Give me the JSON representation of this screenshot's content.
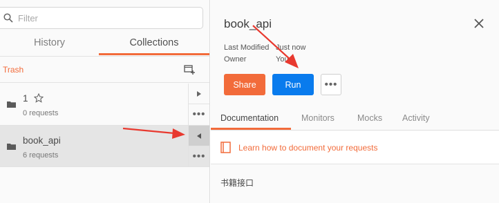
{
  "sidebar": {
    "filter": {
      "placeholder": "Filter"
    },
    "tabs": [
      {
        "label": "History",
        "active": false
      },
      {
        "label": "Collections",
        "active": true
      }
    ],
    "trash_label": "Trash",
    "collections": [
      {
        "name": "1",
        "count_text": "0 requests",
        "starred_icon": "star-outline-icon",
        "selected": false
      },
      {
        "name": "book_api",
        "count_text": "6 requests",
        "selected": true
      }
    ]
  },
  "panel": {
    "title": "book_api",
    "meta": [
      {
        "label": "Last Modified",
        "value": "Just now"
      },
      {
        "label": "Owner",
        "value": "You"
      }
    ],
    "buttons": {
      "share": "Share",
      "run": "Run"
    },
    "tabs": [
      {
        "label": "Documentation",
        "active": true
      },
      {
        "label": "Monitors",
        "active": false
      },
      {
        "label": "Mocks",
        "active": false
      },
      {
        "label": "Activity",
        "active": false
      }
    ],
    "doc_link": "Learn how to document your requests",
    "description": "书籍接口"
  },
  "colors": {
    "accent": "#f26b3a",
    "run_blue": "#097bed",
    "annotation_arrow": "#e8392f"
  }
}
